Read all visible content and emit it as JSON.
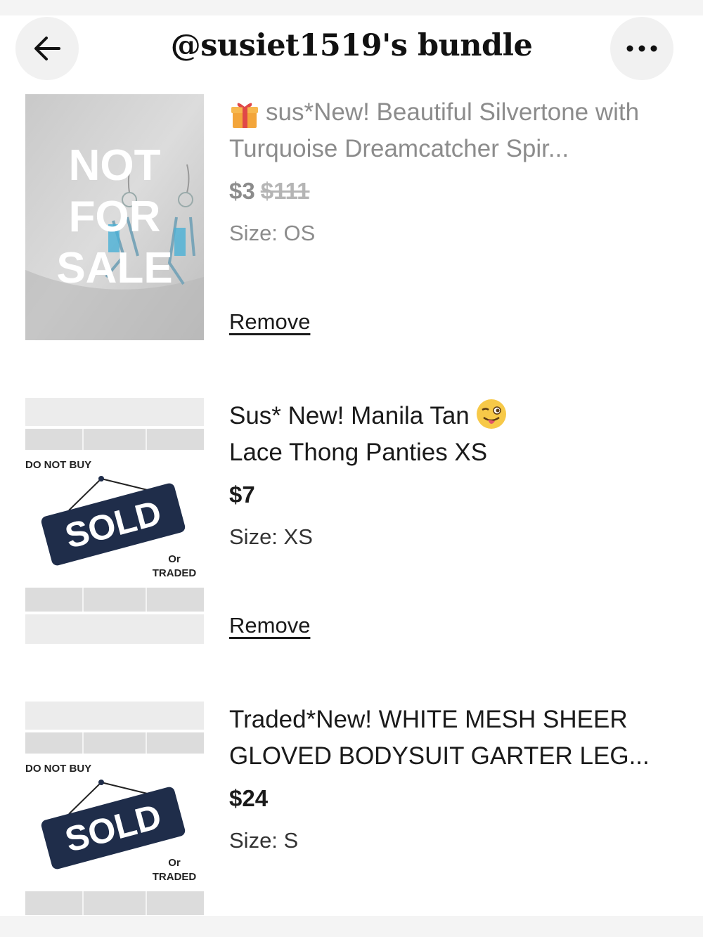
{
  "header": {
    "title": "@susiet1519's bundle",
    "back_icon": "arrow-left-icon",
    "more_icon": "more-horizontal-icon"
  },
  "items": [
    {
      "title_emoji": "gift-icon",
      "title": "sus*New! Beautiful Silvertone with Turquoise Dreamcatcher Spir...",
      "price": "$3",
      "original_price": "$111",
      "size": "Size: OS",
      "remove_label": "Remove",
      "thumb_text": [
        "NOT",
        "FOR",
        "SALE"
      ]
    },
    {
      "title_part1": "Sus* New! Manila Tan",
      "title_emoji": "winking-tongue-face-icon",
      "title_part2": "Lace Thong Panties XS",
      "price": "$7",
      "size": "Size: XS",
      "remove_label": "Remove",
      "thumb_top_text": "DO NOT BUY",
      "thumb_sign_text": "SOLD",
      "thumb_or_text": "Or",
      "thumb_traded_text": "TRADED"
    },
    {
      "title": "Traded*New! WHITE MESH SHEER GLOVED BODYSUIT GARTER LEG...",
      "price": "$24",
      "size": "Size: S",
      "thumb_top_text": "DO NOT BUY",
      "thumb_sign_text": "SOLD",
      "thumb_or_text": "Or",
      "thumb_traded_text": "TRADED"
    }
  ]
}
